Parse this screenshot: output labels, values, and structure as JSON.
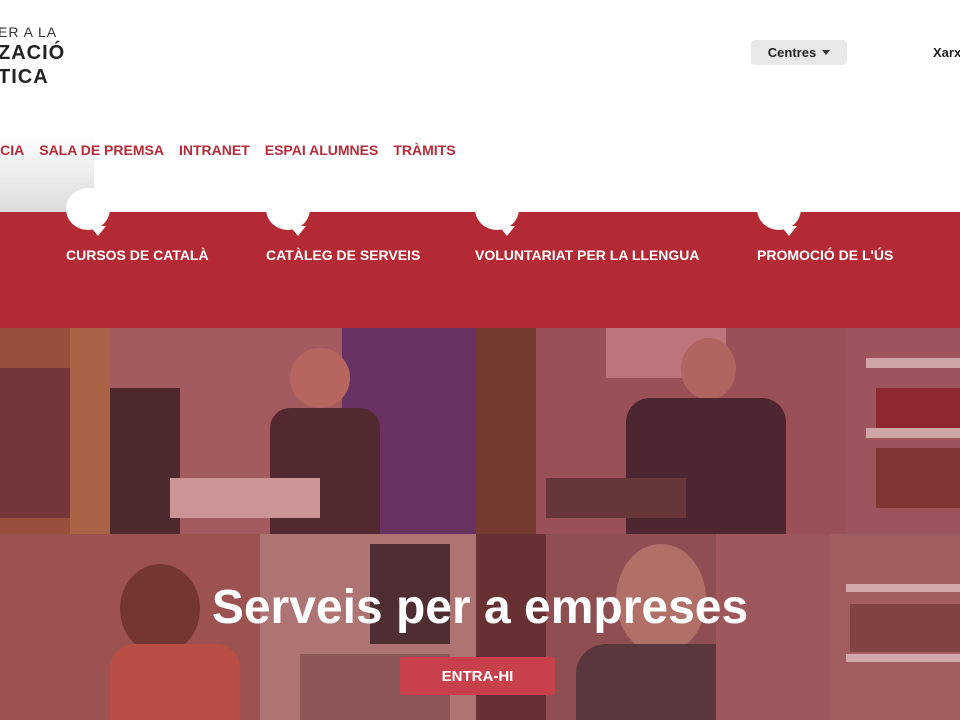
{
  "logo": {
    "line1": "ER A LA",
    "line2": "ZACIÓ",
    "line3": "TICA"
  },
  "header": {
    "centres_label": "Centres",
    "xarxa_label": "Xarx"
  },
  "nav": {
    "items": [
      "NCIA",
      "SALA DE PREMSA",
      "INTRANET",
      "ESPAI ALUMNES",
      "TRÀMITS"
    ]
  },
  "services": {
    "items": [
      "CURSOS DE CATALÀ",
      "CATÀLEG DE SERVEIS",
      "VOLUNTARIAT PER LA LLENGUA",
      "PROMOCIÓ DE L'ÚS"
    ]
  },
  "hero": {
    "title": "Serveis per a empreses",
    "button_label": "ENTRA-HI"
  },
  "colors": {
    "brand_red": "#b42a34",
    "nav_red": "#b52b3a",
    "button_red": "#c8404c"
  },
  "icons": {
    "speech_bubble": "speech-bubble-icon",
    "centres_caret": "chevron-down-icon"
  }
}
